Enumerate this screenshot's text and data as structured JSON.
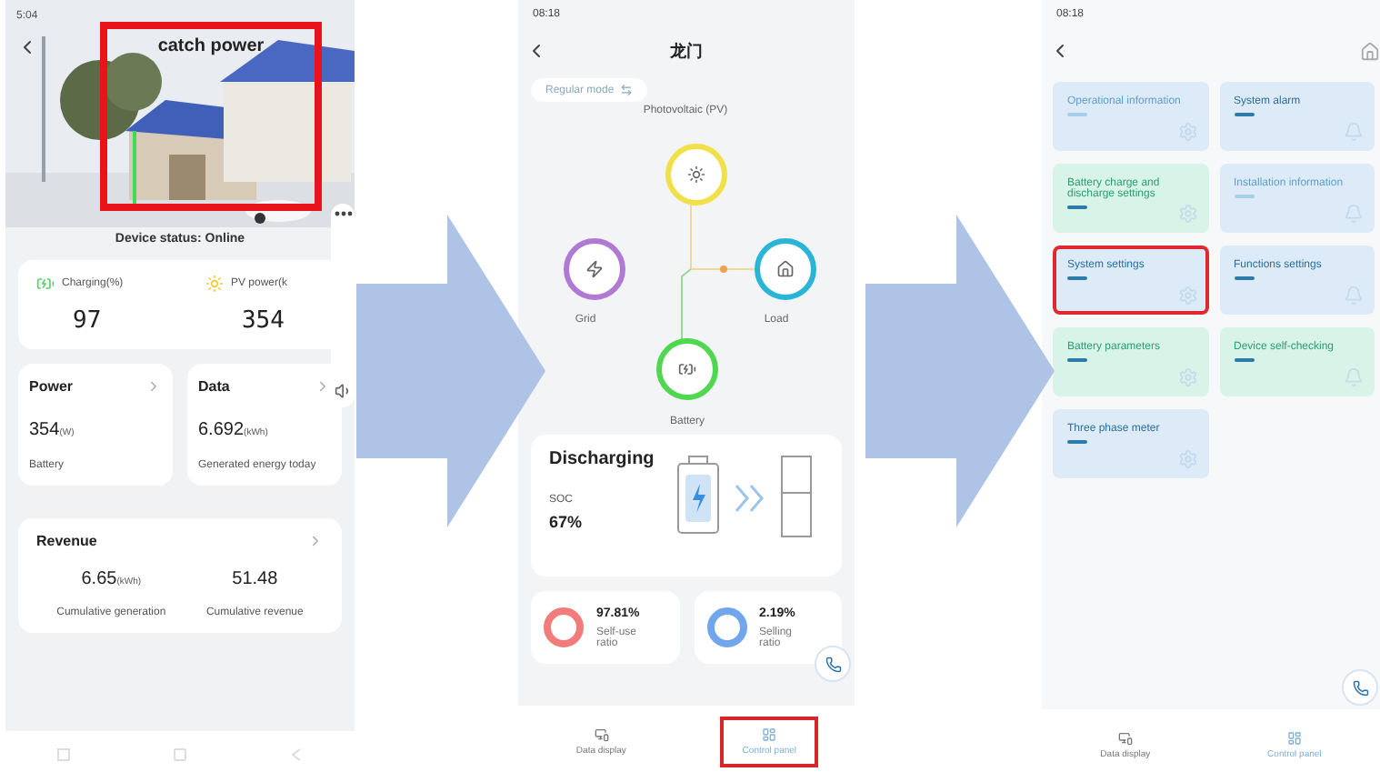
{
  "device_screen": {
    "status_time": "5:04",
    "title": "catch power",
    "title_highlighted": true,
    "device_status": "Device status: Online",
    "metrics": [
      {
        "kind": "battery",
        "label": "Charging(%)",
        "value": "97"
      },
      {
        "kind": "sun",
        "label": "PV power(k",
        "value": "354"
      }
    ],
    "cards": [
      {
        "title": "Power",
        "value": "354",
        "unit": "(W)",
        "caption": "Battery"
      },
      {
        "title": "Data",
        "value": "6.692",
        "unit": "(kWh)",
        "caption": "Generated energy today"
      }
    ],
    "revenue": {
      "title": "Revenue",
      "items": [
        {
          "value": "6.65",
          "unit": "(kWh)",
          "caption": "Cumulative generation"
        },
        {
          "value": "51.48",
          "caption": "Cumulative revenue"
        }
      ]
    }
  },
  "flow_screen": {
    "status_time": "08:18",
    "title": "龙门",
    "mode": "Regular mode",
    "nodes": [
      {
        "kind": "pv",
        "label": "Photovoltaic (PV)",
        "color": "#f0e04a"
      },
      {
        "kind": "grid",
        "label": "Grid",
        "color": "#b07ad4"
      },
      {
        "kind": "load",
        "label": "Load",
        "color": "#2ab4d8"
      },
      {
        "kind": "battery",
        "label": "Battery",
        "color": "#4fd84f"
      }
    ],
    "battery": {
      "state": "Discharging",
      "soc_label": "SOC",
      "soc": "67%"
    },
    "ratios": [
      {
        "value": "97.81%",
        "label": "Self-use ratio",
        "color": "#f27c7c"
      },
      {
        "value": "2.19%",
        "label": "Selling ratio",
        "color": "#72a6ec"
      }
    ],
    "nav": [
      {
        "label": "Data display",
        "selected": false,
        "highlighted": false
      },
      {
        "label": "Control panel",
        "selected": true,
        "highlighted": true
      }
    ]
  },
  "control_screen": {
    "status_time": "08:18",
    "tiles": [
      {
        "label": "Operational information",
        "color": "#dcebf7",
        "disabled": true,
        "highlighted": false
      },
      {
        "label": "System alarm",
        "color": "#dcebf7",
        "disabled": false,
        "highlighted": false
      },
      {
        "label": "Battery charge and discharge settings",
        "color": "#d8f3e8",
        "disabled": false,
        "highlighted": false
      },
      {
        "label": "Installation information",
        "color": "#dcebf7",
        "disabled": true,
        "highlighted": false
      },
      {
        "label": "System settings",
        "color": "#dcebf7",
        "disabled": false,
        "highlighted": true
      },
      {
        "label": "Functions settings",
        "color": "#dcebf7",
        "disabled": false,
        "highlighted": false
      },
      {
        "label": "Battery parameters",
        "color": "#d8f3e8",
        "disabled": false,
        "highlighted": false
      },
      {
        "label": "Device self-checking",
        "color": "#d8f3e8",
        "disabled": false,
        "highlighted": false
      },
      {
        "label": "Three phase meter",
        "color": "#dcebf7",
        "disabled": false,
        "highlighted": false
      }
    ],
    "nav": [
      {
        "label": "Data display",
        "selected": false
      },
      {
        "label": "Control panel",
        "selected": true
      }
    ]
  }
}
